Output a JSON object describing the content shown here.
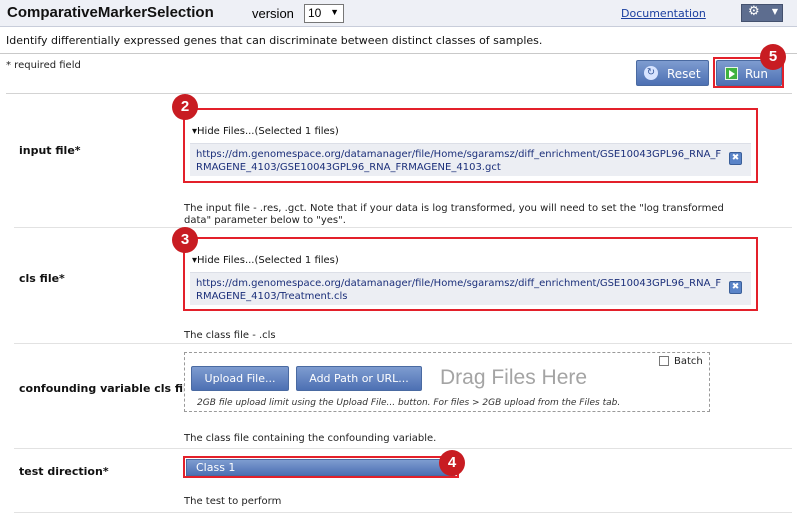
{
  "header": {
    "module_name": "ComparativeMarkerSelection",
    "version_label": "version",
    "version_value": "10",
    "documentation_link": "Documentation",
    "gear_icon": "gear-icon"
  },
  "description": "Identify differentially expressed genes that can discriminate between distinct classes of samples.",
  "required_note": "* required field",
  "buttons": {
    "reset": "Reset",
    "run": "Run"
  },
  "callouts": [
    "2",
    "3",
    "4",
    "5"
  ],
  "params": {
    "input_file": {
      "label": "input file*",
      "toggle": "▾Hide Files...(Selected 1 files)",
      "file_url": "https://dm.genomespace.org/datamanager/file/Home/sgaramsz/diff_enrichment/GSE10043GPL96_RNA_FRMAGENE_4103/GSE10043GPL96_RNA_FRMAGENE_4103.gct",
      "help": "The input file - .res, .gct. Note that if your data is log transformed, you will need to set the \"log transformed data\" parameter below to \"yes\"."
    },
    "cls_file": {
      "label": "cls file*",
      "toggle": "▾Hide Files...(Selected 1 files)",
      "file_url": "https://dm.genomespace.org/datamanager/file/Home/sgaramsz/diff_enrichment/GSE10043GPL96_RNA_FRMAGENE_4103/Treatment.cls",
      "help": "The class file - .cls"
    },
    "confounding": {
      "label": "confounding variable cls file",
      "upload_button": "Upload File...",
      "add_path_button": "Add Path or URL...",
      "drag_text": "Drag Files Here",
      "batch_label": "Batch",
      "upload_note": "2GB file upload limit using the Upload File... button. For files > 2GB upload from the Files tab.",
      "help": "The class file containing the confounding variable."
    },
    "test_direction": {
      "label": "test direction*",
      "selected": "Class 1",
      "help": "The test to perform"
    }
  },
  "colors": {
    "accent_blue": "#4d70b3",
    "callout_red": "#e3202a",
    "run_green": "#3fb23f"
  }
}
